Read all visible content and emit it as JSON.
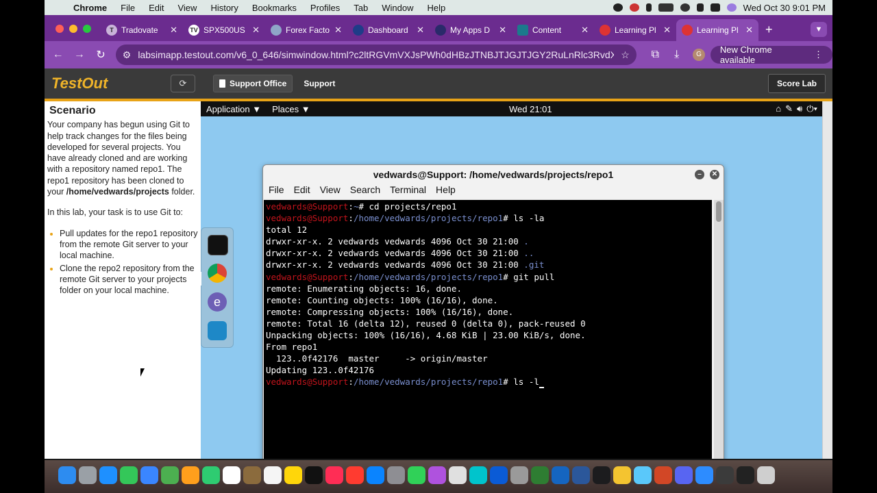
{
  "menubar": {
    "app": "Chrome",
    "items": [
      "File",
      "Edit",
      "View",
      "History",
      "Bookmarks",
      "Profiles",
      "Tab",
      "Window",
      "Help"
    ],
    "clock": "Wed Oct 30  9:01 PM"
  },
  "tabs": [
    {
      "label": "Tradovate",
      "fav": "T"
    },
    {
      "label": "SPX500US",
      "fav": "TV"
    },
    {
      "label": "Forex Facto",
      "fav": ""
    },
    {
      "label": "Dashboard",
      "fav": ""
    },
    {
      "label": "My Apps D",
      "fav": ""
    },
    {
      "label": "Content",
      "fav": ""
    },
    {
      "label": "Learning Pl",
      "fav": ""
    },
    {
      "label": "Learning Pl",
      "fav": ""
    }
  ],
  "toolbar": {
    "url": "labsimapp.testout.com/v6_0_646/simwindow.html?c2ltRGVmVXJsPWh0dHBzJTNBJTJGJTJGY2RuLnRlc3RvdXQ...",
    "avatar": "G",
    "update_label": "New Chrome available"
  },
  "testout": {
    "logo": "TestOut",
    "crumb_office": "Support Office",
    "crumb_current": "Support",
    "score_label": "Score Lab"
  },
  "scenario": {
    "title": "Scenario",
    "p1_a": "Your company has begun using Git to help track changes for the files being developed for several projects. You have already cloned and are working with a repository named repo1. The repo1 repository has been cloned to your ",
    "p1_path": "/home/vedwards/projects",
    "p1_b": " folder.",
    "p2": "In this lab, your task is to use Git to:",
    "tasks": [
      "Pull updates for the repo1 repository from the remote Git server to your local machine.",
      "Clone the repo2 repository from the remote Git server to your projects folder on your local machine."
    ]
  },
  "vm": {
    "menu_app": "Application ▼",
    "menu_places": "Places ▼",
    "clock": "Wed 21:01"
  },
  "terminal": {
    "title": "vedwards@Support: /home/vedwards/projects/repo1",
    "menu": [
      "File",
      "Edit",
      "View",
      "Search",
      "Terminal",
      "Help"
    ],
    "user": "vedwards@Support",
    "lines": [
      {
        "type": "prompt",
        "path": "~",
        "cmd": "cd projects/repo1"
      },
      {
        "type": "prompt",
        "path": "/home/vedwards/projects/repo1",
        "cmd": "ls -la"
      },
      {
        "type": "out",
        "text": "total 12"
      },
      {
        "type": "ls",
        "text": "drwxr-xr-x. 2 vedwards vedwards 4096 Oct 30 21:00 ",
        "name": "."
      },
      {
        "type": "ls",
        "text": "drwxr-xr-x. 2 vedwards vedwards 4096 Oct 30 21:00 ",
        "name": ".."
      },
      {
        "type": "ls",
        "text": "drwxr-xr-x. 2 vedwards vedwards 4096 Oct 30 21:00 ",
        "name": ".git"
      },
      {
        "type": "prompt",
        "path": "/home/vedwards/projects/repo1",
        "cmd": "git pull"
      },
      {
        "type": "out",
        "text": "remote: Enumerating objects: 16, done."
      },
      {
        "type": "out",
        "text": "remote: Counting objects: 100% (16/16), done."
      },
      {
        "type": "out",
        "text": "remote: Compressing objects: 100% (16/16), done."
      },
      {
        "type": "out",
        "text": "remote: Total 16 (delta 12), reused 0 (delta 0), pack-reused 0"
      },
      {
        "type": "out",
        "text": "Unpacking objects: 100% (16/16), 4.68 KiB | 23.00 KiB/s, done."
      },
      {
        "type": "out",
        "text": "From repo1"
      },
      {
        "type": "out",
        "text": "  123..0f42176  master     -> origin/master"
      },
      {
        "type": "out",
        "text": "Updating 123..0f42176"
      },
      {
        "type": "prompt",
        "path": "/home/vedwards/projects/repo1",
        "cmd": "ls -l",
        "cursor": true
      }
    ]
  },
  "colors": {
    "tabstrip": "#6b2c8f",
    "toolbar": "#8a4bb2",
    "testout_accent": "#e8a317",
    "prompt_user": "#c4141c",
    "prompt_path": "#7a8fcf",
    "desktop": "#8ec9f0"
  },
  "dock_apps": [
    "finder-icon",
    "launchpad-icon",
    "safari-icon",
    "messages-icon",
    "mail-icon",
    "maps-icon",
    "photos-icon",
    "facetime-icon",
    "calendar-icon",
    "notes-brown-icon",
    "reminders-icon",
    "notes-icon",
    "appletv-icon",
    "music-icon",
    "news-icon",
    "appstore-icon",
    "settings-icon",
    "facetime-green-icon",
    "podcasts-icon",
    "chrome-icon",
    "canva-icon",
    "network-icon",
    "compressor-icon",
    "tree-icon",
    "vpn-icon",
    "word-icon",
    "terminal-icon",
    "python-icon",
    "preview-icon",
    "powerpoint-icon",
    "discord-icon",
    "zoom-icon",
    "camera-icon",
    "screen-icon",
    "trash-icon"
  ]
}
